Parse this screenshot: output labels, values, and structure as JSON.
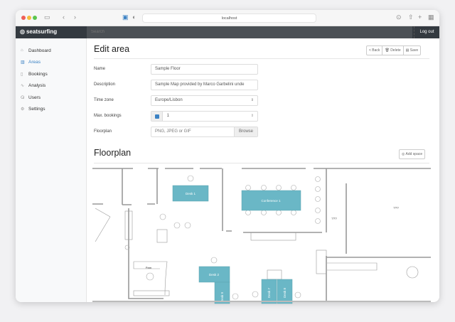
{
  "browser": {
    "url": "localhost"
  },
  "navbar": {
    "brand": "seatsurfing",
    "search_placeholder": "Search",
    "logout": "Log out"
  },
  "sidebar": {
    "items": [
      {
        "label": "Dashboard",
        "icon": "home-icon"
      },
      {
        "label": "Areas",
        "icon": "map-icon",
        "active": true
      },
      {
        "label": "Bookings",
        "icon": "book-icon"
      },
      {
        "label": "Analysis",
        "icon": "activity-icon"
      },
      {
        "label": "Users",
        "icon": "users-icon"
      },
      {
        "label": "Settings",
        "icon": "gear-icon"
      }
    ]
  },
  "page": {
    "title": "Edit area",
    "back": "< Back",
    "delete": "Delete",
    "save": "Save"
  },
  "form": {
    "name_label": "Name",
    "name_value": "Sample Floor",
    "description_label": "Description",
    "description_value": "Sample Map provided by Marco Garbelini unde",
    "timezone_label": "Time zone",
    "timezone_value": "Europe/Lisbon",
    "max_label": "Max. bookings",
    "max_checked": true,
    "max_value": "1",
    "floorplan_label": "Floorplan",
    "floorplan_placeholder": "PNG, JPEG or GIF",
    "browse": "Browse"
  },
  "floorplan": {
    "title": "Floorplan",
    "add_space": "Add space",
    "spaces": [
      "Desk 1",
      "Conference 1",
      "Desk 2",
      "Desk 9",
      "Desk 7",
      "Desk 8"
    ],
    "room_labels": [
      "???",
      "???",
      "Pam"
    ],
    "space_color": "#6ab7c6"
  },
  "colors": {
    "navbar": "#343a40",
    "accent": "#3b82c4"
  }
}
